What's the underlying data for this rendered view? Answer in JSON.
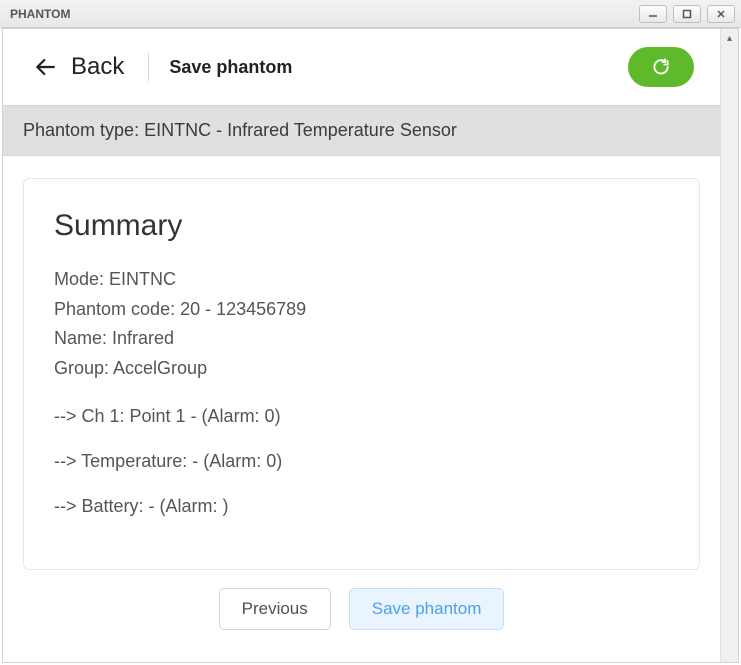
{
  "window": {
    "title": "PHANTOM"
  },
  "header": {
    "back_label": "Back",
    "title": "Save phantom"
  },
  "banner": {
    "text": "Phantom type: EINTNC - Infrared Temperature Sensor"
  },
  "summary": {
    "heading": "Summary",
    "mode_line": "Mode: EINTNC",
    "code_line": "Phantom code: 20 - 123456789",
    "name_line": "Name: Infrared",
    "group_line": "Group: AccelGroup",
    "channels": [
      "--> Ch 1: Point 1 - (Alarm: 0)",
      "--> Temperature: - (Alarm: 0)",
      "--> Battery: - (Alarm: )"
    ]
  },
  "footer": {
    "previous_label": "Previous",
    "save_label": "Save phantom"
  }
}
